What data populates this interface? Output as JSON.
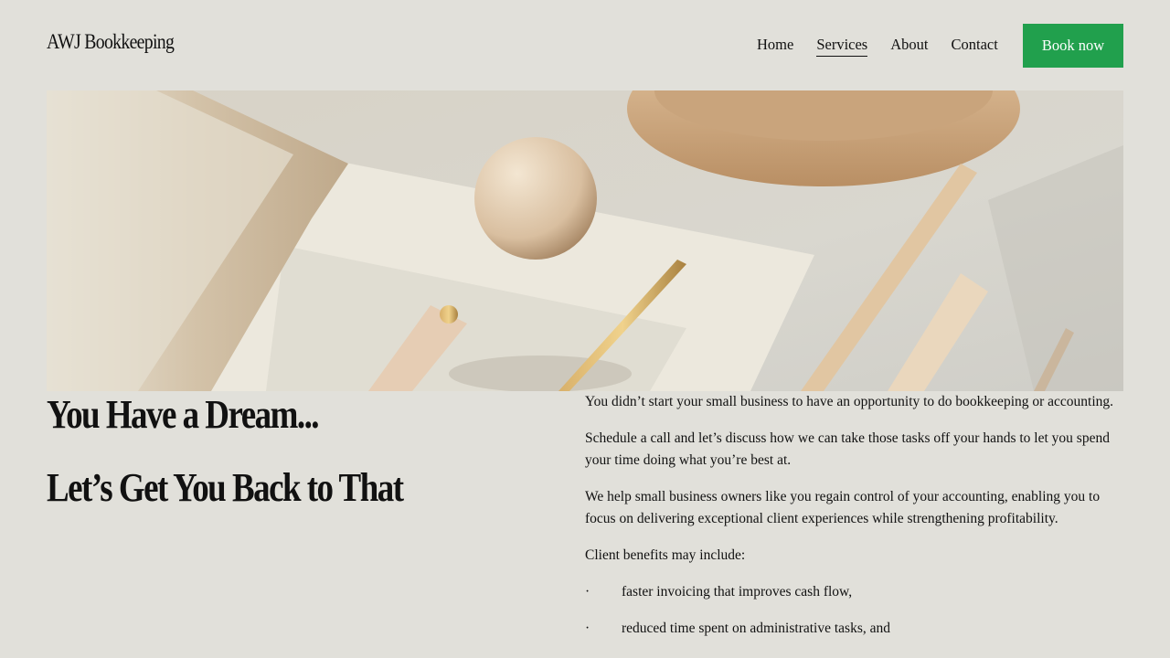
{
  "header": {
    "brand": "AWJ Bookkeeping",
    "nav": [
      {
        "label": "Home",
        "active": false
      },
      {
        "label": "Services",
        "active": true
      },
      {
        "label": "About",
        "active": false
      },
      {
        "label": "Contact",
        "active": false
      }
    ],
    "cta_label": "Book now"
  },
  "hero": {
    "headline_1": "You Have a Dream...",
    "headline_2": "Let’s Get You Back to That"
  },
  "content": {
    "paragraphs": [
      "You didn’t start your small business to have an opportunity to do bookkeeping or accounting.",
      "Schedule a call and let’s discuss how we can take those tasks off your hands to let you spend your time doing what you’re best at.",
      "We help small business owners like you regain control of your accounting, enabling you to focus on delivering exceptional client experiences while strengthening profitability.",
      "Client benefits may include:"
    ],
    "bullets": [
      "faster invoicing that improves cash flow,",
      "reduced time spent on administrative tasks, and"
    ],
    "bullet_marker": "·"
  },
  "colors": {
    "background": "#e1e0da",
    "accent": "#21a04d",
    "text": "#111111"
  }
}
